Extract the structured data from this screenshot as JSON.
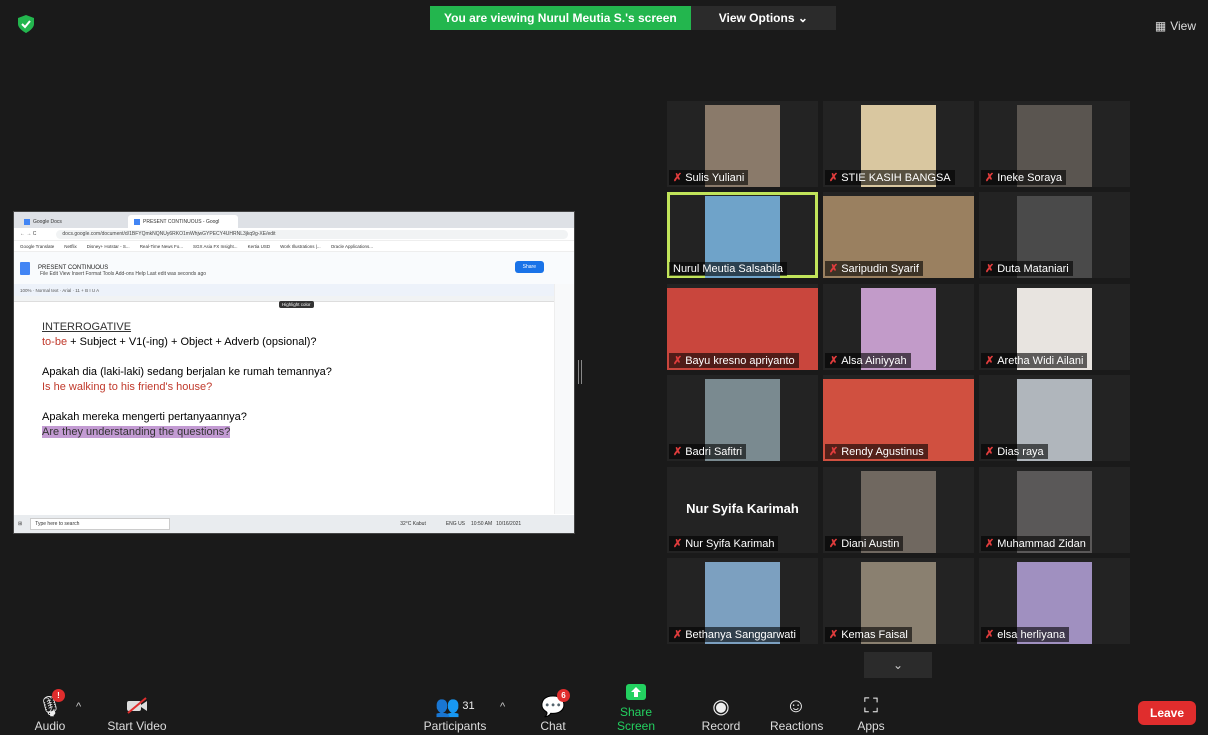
{
  "banner": {
    "viewing_text": "You are viewing Nurul Meutia S.'s screen",
    "view_options": "View Options"
  },
  "top_right": {
    "view_label": "View"
  },
  "shared_screen": {
    "tabs": [
      "Google Docs",
      "PRESENT CONTINUOUS - Googl"
    ],
    "url": "docs.google.com/document/d/1BFYQmkNQNUy6RKO1mWhjwGYPECY4UHRNL3jkq9g-XE/edit",
    "bookmarks": [
      "Google Translate",
      "Netflix",
      "Disney+ Hotstar - S...",
      "Real-Time News Fo...",
      "SGX Asia FX Insight...",
      "Kertia USD",
      "Work Illustrations |...",
      "Oracle Applications..."
    ],
    "doc_title": "PRESENT CONTINUOUS",
    "doc_menu": "File  Edit  View  Insert  Format  Tools  Add-ons  Help   Last edit was seconds ago",
    "share_label": "Share",
    "toolbar": "100%  ·  Normal text  ·  Arial  ·  11  +  B  I  U  A",
    "tooltip": "Highlight color",
    "lines": {
      "l1": "INTERROGATIVE",
      "l2a": "to-be",
      "l2b": " + Subject + V1(-ing) + Object + Adverb (opsional)?",
      "l3": "Apakah dia (laki-laki) sedang berjalan ke rumah temannya?",
      "l4": "Is he walking to his friend's house?",
      "l5": "Apakah mereka mengerti pertanyaannya?",
      "l6": "Are they understanding the questions?"
    },
    "taskbar_search": "Type here to search",
    "taskbar_weather": "32°C Kabut",
    "taskbar_time": "10:50 AM",
    "taskbar_date": "10/16/2021",
    "taskbar_lang": "ENG US"
  },
  "participants": [
    {
      "name": "Sulis Yuliani",
      "muted": true
    },
    {
      "name": "STIE KASIH BANGSA",
      "muted": true
    },
    {
      "name": "Ineke Soraya",
      "muted": true
    },
    {
      "name": "Nurul Meutia Salsabila",
      "muted": false
    },
    {
      "name": "Saripudin Syarif",
      "muted": true
    },
    {
      "name": "Duta Mataniari",
      "muted": true
    },
    {
      "name": "Bayu kresno apriyanto",
      "muted": true
    },
    {
      "name": "Alsa Ainiyyah",
      "muted": true
    },
    {
      "name": "Aretha Widi Ailani",
      "muted": true
    },
    {
      "name": "Badri Safitri",
      "muted": true
    },
    {
      "name": "Rendy Agustinus",
      "muted": true
    },
    {
      "name": "Dias raya",
      "muted": true
    },
    {
      "name": "Nur Syifa Karimah",
      "muted": true
    },
    {
      "name": "Diani Austin",
      "muted": true
    },
    {
      "name": "Muhammad Zidan",
      "muted": true
    },
    {
      "name": "Bethanya Sanggarwati",
      "muted": true
    },
    {
      "name": "Kemas Faisal",
      "muted": true
    },
    {
      "name": "elsa herliyana",
      "muted": true
    }
  ],
  "name_only_tile": "Nur Syifa Karimah",
  "controls": {
    "audio": "Audio",
    "audio_badge": "!",
    "video": "Start Video",
    "participants": "Participants",
    "participants_count": "31",
    "chat": "Chat",
    "chat_badge": "6",
    "share": "Share Screen",
    "record": "Record",
    "reactions": "Reactions",
    "apps": "Apps",
    "leave": "Leave"
  }
}
